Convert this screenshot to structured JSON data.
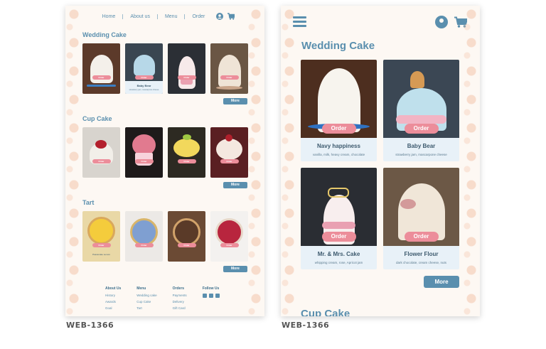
{
  "frames": [
    {
      "label": "WEB-1366",
      "nav": {
        "home": "Home",
        "about": "About us",
        "menu": "Menu",
        "order": "Order"
      },
      "sections": [
        {
          "title": "Wedding Cake",
          "more": "More",
          "cards": [
            {
              "order": "Order",
              "bg": "#5c3a2a",
              "cake": "#f4f0ea",
              "accent": "#3b7fc4",
              "name": ""
            },
            {
              "order": "Order",
              "bg": "#3a4651",
              "cake": "#b7d8e8",
              "accent": "#f1b6c1",
              "name": "Baby Bear",
              "desc": "strawberry jam, mascarpone cheese"
            },
            {
              "order": "Order",
              "bg": "#2b2f35",
              "cake": "#f7eaea",
              "accent": "#eaa1b1",
              "name": ""
            },
            {
              "order": "Order",
              "bg": "#6a5644",
              "cake": "#efe4d6",
              "accent": "#c9a58a",
              "name": ""
            }
          ]
        },
        {
          "title": "Cup Cake",
          "more": "More",
          "cards": [
            {
              "order": "Order",
              "bg": "#d8d4ce",
              "cake": "#f2efe9",
              "accent": "#b3202d"
            },
            {
              "order": "Order",
              "bg": "#1e1a1a",
              "cake": "#e17a8f",
              "accent": "#f7d3dc"
            },
            {
              "order": "Order",
              "bg": "#2d2a22",
              "cake": "#f2d85c",
              "accent": "#9fc843"
            },
            {
              "order": "Order",
              "bg": "#5a1f22",
              "cake": "#f4e8e0",
              "accent": "#b0202c"
            }
          ]
        },
        {
          "title": "Tart",
          "more": "More",
          "cards": [
            {
              "order": "Order",
              "bg": "#e9d8a6",
              "cake": "#f4cc3c",
              "accent": "#6d8b3b",
              "name": "Passionate Lemon"
            },
            {
              "order": "Order",
              "bg": "#ece9e6",
              "cake": "#7f9fd1",
              "accent": "#d8b56b"
            },
            {
              "order": "Order",
              "bg": "#6b4a34",
              "cake": "#5a3a28",
              "accent": "#d1a26a"
            },
            {
              "order": "Order",
              "bg": "#f3f1ef",
              "cake": "#b8253e",
              "accent": "#e7d7c8"
            }
          ]
        }
      ],
      "footer": {
        "about": {
          "title": "About Us",
          "items": [
            "History",
            "Awards",
            "Goal"
          ]
        },
        "menu": {
          "title": "Menu",
          "items": [
            "Wedding cake",
            "Cup Cake",
            "Tart"
          ]
        },
        "orders": {
          "title": "Orders",
          "items": [
            "Payments",
            "Delivery",
            "Gift Card"
          ]
        },
        "follow": {
          "title": "Follow Us"
        }
      }
    },
    {
      "label": "WEB-1366",
      "section_title": "Wedding Cake",
      "more": "More",
      "cards": [
        {
          "order": "Order",
          "name": "Navy happiness",
          "desc": "vanilla, milk, heavy cream, chocolate",
          "bg": "#4d2e1f",
          "cake": "#f7f4ee",
          "accent": "#2f72c2"
        },
        {
          "order": "Order",
          "name": "Baby Bear",
          "desc": "strawberry jam, mascarpone cheese",
          "bg": "#3b4754",
          "cake": "#bfe0ec",
          "accent": "#f2b4c4"
        },
        {
          "order": "Order",
          "name": "Mr. & Mrs. Cake",
          "desc": "whipping cream, rose, Apricot jam",
          "bg": "#2a2d33",
          "cake": "#f8eeee",
          "accent": "#e9a0b2"
        },
        {
          "order": "Order",
          "name": "Flower Flour",
          "desc": "dark chocolate, cream cheese, nuts",
          "bg": "#6c5846",
          "cake": "#f0e6d8",
          "accent": "#d39a9a"
        }
      ],
      "next_section_title": "Cup Cake"
    }
  ]
}
